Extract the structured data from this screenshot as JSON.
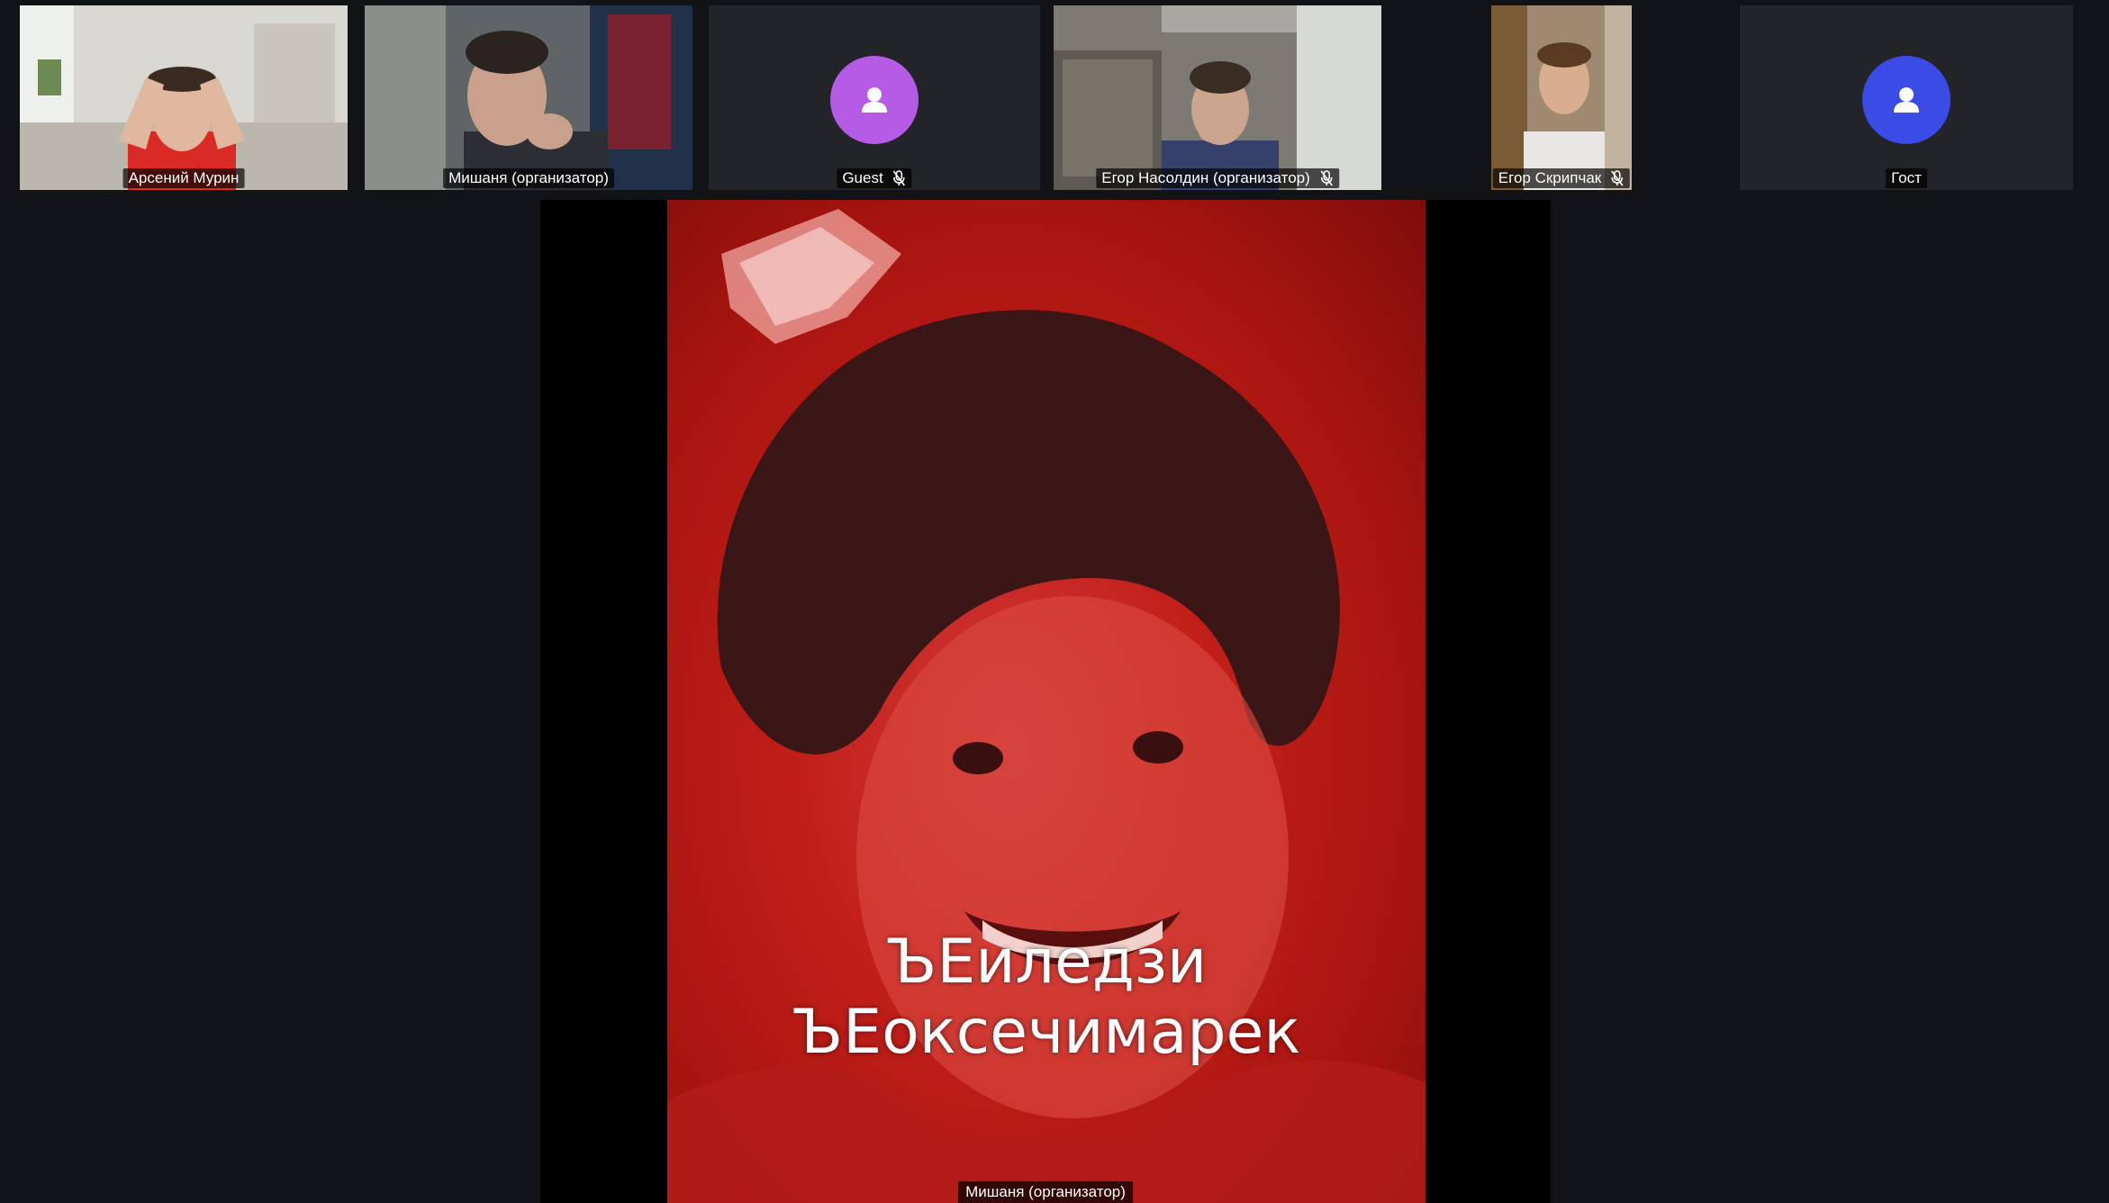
{
  "participants": [
    {
      "name": "Арсений Мурин",
      "muted": false,
      "has_video": true
    },
    {
      "name": "Мишаня (организатор)",
      "muted": false,
      "has_video": true
    },
    {
      "name": "Guest",
      "muted": true,
      "has_video": false,
      "avatar_color": "#b55be6"
    },
    {
      "name": "Егор Насолдин (организатор)",
      "muted": true,
      "has_video": true
    },
    {
      "name": "Егор Скрипчак",
      "muted": true,
      "has_video": true
    },
    {
      "name": "Гост",
      "muted": false,
      "has_video": false,
      "avatar_color": "#3a4be6"
    }
  ],
  "speaker": {
    "name": "Мишаня (организатор)",
    "caption_line1": "ЪЕиледзи",
    "caption_line2": "ЪЕоксечимарек"
  },
  "colors": {
    "background": "#111316",
    "tile_background": "#232428",
    "speaker_tint": "#c21f1a"
  }
}
